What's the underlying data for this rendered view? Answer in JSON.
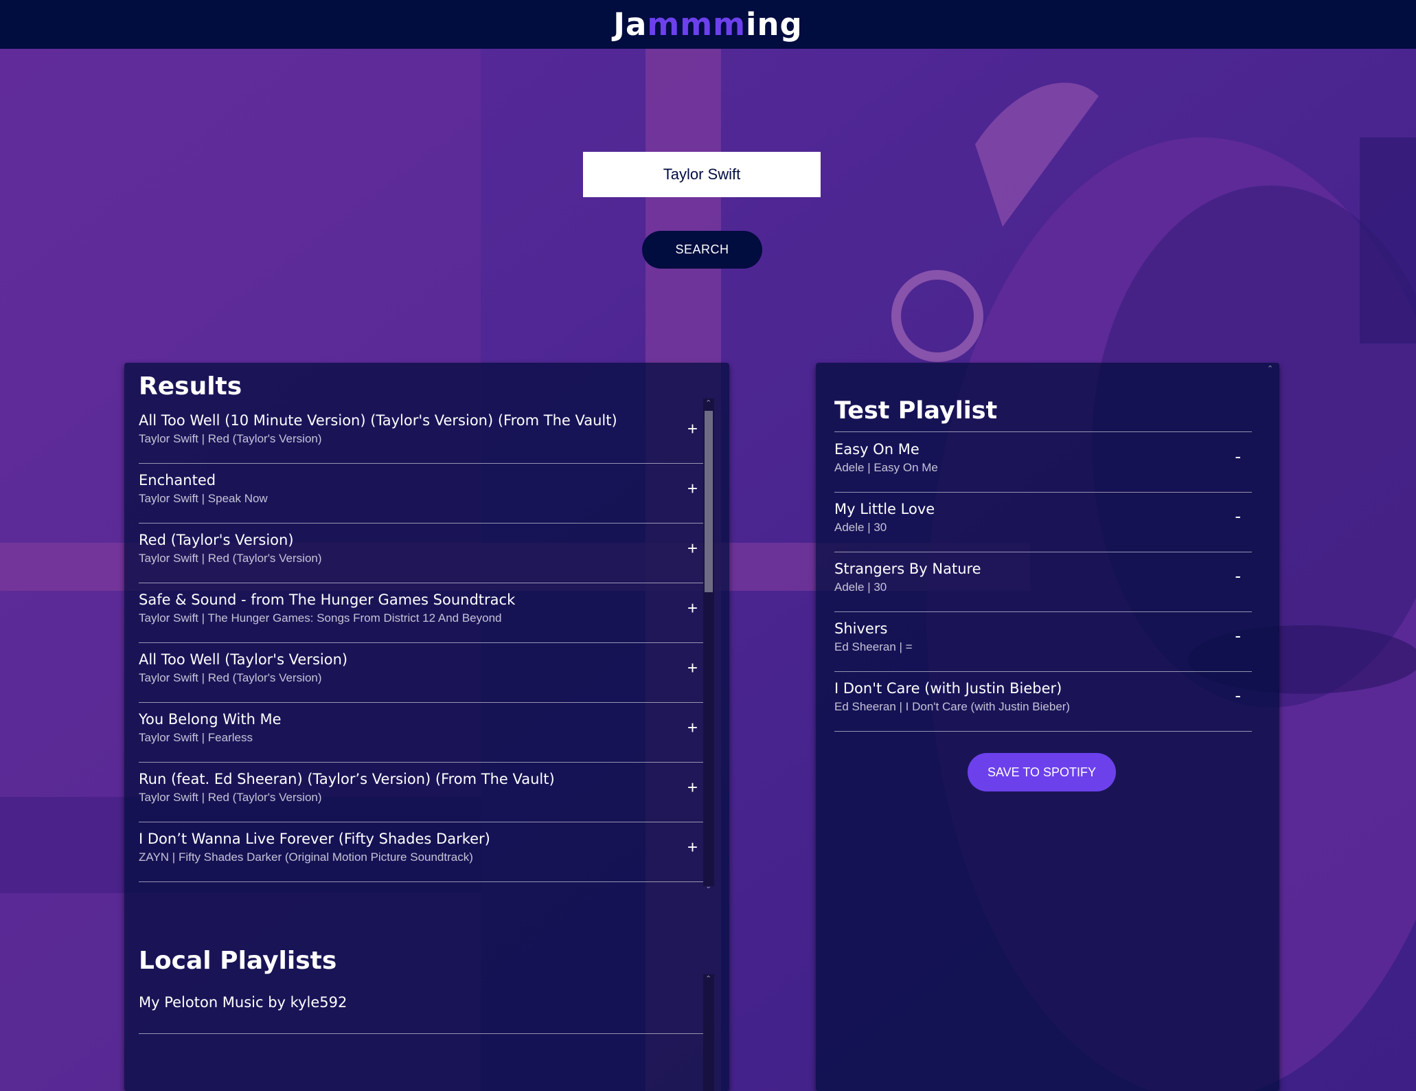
{
  "header": {
    "logo_prefix": "Ja",
    "logo_accent": "mmm",
    "logo_suffix": "ing"
  },
  "search": {
    "value": "Taylor Swift",
    "button_label": "SEARCH"
  },
  "results": {
    "title": "Results",
    "tracks": [
      {
        "name": "All Too Well (10 Minute Version) (Taylor's Version) (From The Vault)",
        "meta": "Taylor Swift | Red (Taylor's Version)",
        "action": "+"
      },
      {
        "name": "Enchanted",
        "meta": "Taylor Swift | Speak Now",
        "action": "+"
      },
      {
        "name": "Red (Taylor's Version)",
        "meta": "Taylor Swift | Red (Taylor's Version)",
        "action": "+"
      },
      {
        "name": "Safe & Sound - from The Hunger Games Soundtrack",
        "meta": "Taylor Swift | The Hunger Games: Songs From District 12 And Beyond",
        "action": "+"
      },
      {
        "name": "All Too Well (Taylor's Version)",
        "meta": "Taylor Swift | Red (Taylor's Version)",
        "action": "+"
      },
      {
        "name": "You Belong With Me",
        "meta": "Taylor Swift | Fearless",
        "action": "+"
      },
      {
        "name": "Run (feat. Ed Sheeran) (Taylor’s Version) (From The Vault)",
        "meta": "Taylor Swift | Red (Taylor's Version)",
        "action": "+"
      },
      {
        "name": "I Don’t Wanna Live Forever (Fifty Shades Darker)",
        "meta": "ZAYN | Fifty Shades Darker (Original Motion Picture Soundtrack)",
        "action": "+"
      }
    ]
  },
  "local_playlists": {
    "title": "Local Playlists",
    "items": [
      {
        "name": "My Peloton Music by kyle592"
      }
    ]
  },
  "playlist": {
    "title": "Test Playlist",
    "tracks": [
      {
        "name": "Easy On Me",
        "meta": "Adele | Easy On Me",
        "action": "-"
      },
      {
        "name": "My Little Love",
        "meta": "Adele | 30",
        "action": "-"
      },
      {
        "name": "Strangers By Nature",
        "meta": "Adele | 30",
        "action": "-"
      },
      {
        "name": "Shivers",
        "meta": "Ed Sheeran | =",
        "action": "-"
      },
      {
        "name": "I Don't Care (with Justin Bieber)",
        "meta": "Ed Sheeran | I Don't Care (with Justin Bieber)",
        "action": "-"
      }
    ],
    "save_label": "SAVE TO SPOTIFY"
  },
  "scroll_glyphs": {
    "up": "⌃",
    "down": "⌄"
  },
  "colors": {
    "header_bg": "#010c3f",
    "accent": "#6c41ec",
    "panel_bg": "#010c3f",
    "background_purple": "#5b2a9e"
  }
}
